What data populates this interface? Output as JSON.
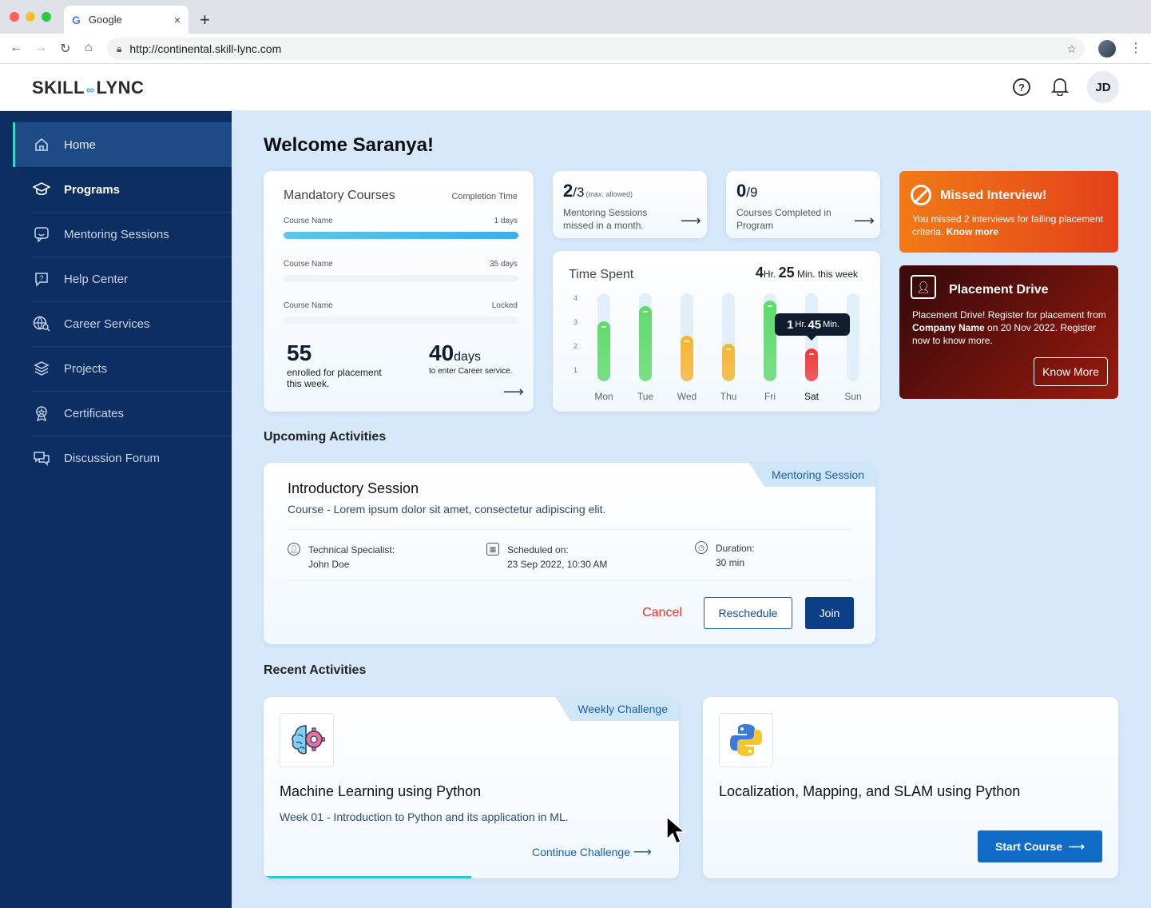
{
  "browser": {
    "tab_title": "Google",
    "url": "http://continental.skill-lync.com",
    "close_glyph": "×",
    "new_tab_glyph": "+"
  },
  "header": {
    "logo_left": "SKILL",
    "logo_right": "LYNC",
    "help_glyph": "?",
    "avatar_initials": "JD"
  },
  "sidebar": {
    "items": [
      {
        "label": "Home",
        "icon": "home-icon"
      },
      {
        "label": "Programs",
        "icon": "graduation-cap-icon"
      },
      {
        "label": "Mentoring Sessions",
        "icon": "chat-smile-icon"
      },
      {
        "label": "Help Center",
        "icon": "help-chat-icon"
      },
      {
        "label": "Career Services",
        "icon": "globe-search-icon"
      },
      {
        "label": "Projects",
        "icon": "layers-icon"
      },
      {
        "label": "Certificates",
        "icon": "award-icon"
      },
      {
        "label": "Discussion Forum",
        "icon": "discussion-icon"
      }
    ]
  },
  "welcome": "Welcome Saranya!",
  "mandatory": {
    "title": "Mandatory Courses",
    "completion_label": "Completion Time",
    "courses": [
      {
        "name": "Course Name",
        "time": "1 days",
        "progress": 1.0
      },
      {
        "name": "Course Name",
        "time": "35 days",
        "progress": 0
      },
      {
        "name": "Course Name",
        "time": "Locked",
        "progress": 0
      }
    ],
    "enrolled_num": "55",
    "enrolled_text": "enrolled for placement this week.",
    "days_num": "40",
    "days_unit": "days",
    "days_text": "to enter Career service."
  },
  "mentoring_stat": {
    "value": "2",
    "total": "/3",
    "note": "(max. allowed)",
    "desc": "Mentoring Sessions missed in a month."
  },
  "courses_stat": {
    "value": "0",
    "total": "/9",
    "desc": "Courses Completed in Program"
  },
  "time_spent": {
    "title": "Time Spent",
    "total_hr": "4",
    "hr_label": "Hr.",
    "total_min": "25",
    "min_label": "Min. this week",
    "tooltip_hr": "1",
    "tooltip_min": "45",
    "tooltip_min_label": "Min."
  },
  "chart_data": {
    "type": "bar",
    "categories": [
      "Mon",
      "Tue",
      "Wed",
      "Thu",
      "Fri",
      "Sat",
      "Sun"
    ],
    "values": [
      2.4,
      3.0,
      1.8,
      1.5,
      3.2,
      1.3,
      0
    ],
    "y_ticks": [
      "4",
      "3",
      "2",
      "1"
    ],
    "ylim": [
      0,
      3.5
    ],
    "colors": [
      "#5fdb6a",
      "#5fdb6a",
      "#f7b531",
      "#f7b531",
      "#5fdb6a",
      "#ef3a3a",
      "#5fdb6a"
    ],
    "selected": "Sat",
    "grid": false
  },
  "missed": {
    "title": "Missed Interview!",
    "desc": "You missed 2 interviews for failing placement criteria.",
    "link": "Know more"
  },
  "drive": {
    "title": "Placement Drive",
    "desc_a": "Placement Drive! Register for placement from ",
    "company": "Company Name",
    "desc_b": " on 20 Nov 2022. Register now to know more.",
    "button": "Know More"
  },
  "upcoming": {
    "section": "Upcoming Activities",
    "tag": "Mentoring Session",
    "title": "Introductory Session",
    "desc": "Course - Lorem ipsum dolor sit amet, consectetur adipiscing elit.",
    "specialist_label": "Technical Specialist:",
    "specialist": "John Doe",
    "scheduled_label": "Scheduled on:",
    "scheduled": "23 Sep 2022, 10:30 AM",
    "duration_label": "Duration:",
    "duration": "30 min",
    "cancel": "Cancel",
    "reschedule": "Reschedule",
    "join": "Join"
  },
  "recent": {
    "section": "Recent Activities",
    "card1": {
      "tag": "Weekly Challenge",
      "title": "Machine Learning using Python",
      "week": "Week 01 - Introduction to Python and its application in ML.",
      "link": "Continue Challenge",
      "progress": 0.5
    },
    "card2": {
      "title": "Localization, Mapping, and SLAM using Python",
      "button": "Start Course"
    }
  }
}
